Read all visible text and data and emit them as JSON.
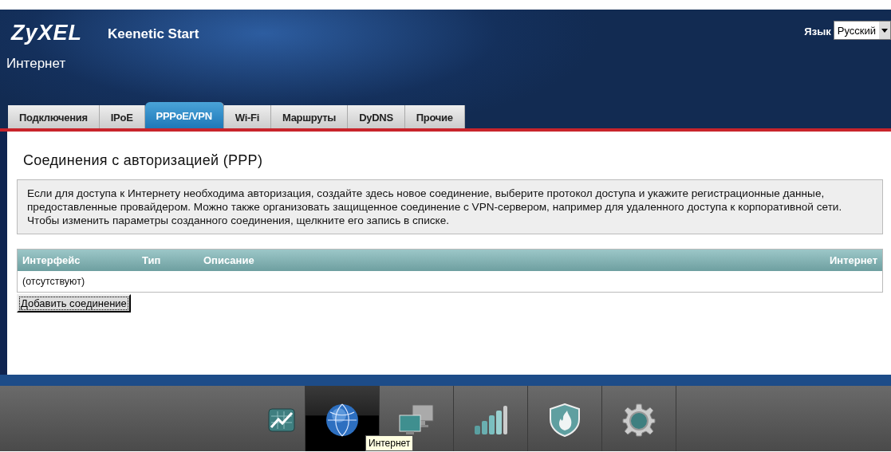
{
  "header": {
    "logo": "ZyXEL",
    "model": "Keenetic Start",
    "language_label": "Язык",
    "language_value": "Русский",
    "section_title": "Интернет"
  },
  "tabs": [
    {
      "label": "Подключения",
      "selected": false
    },
    {
      "label": "IPoE",
      "selected": false
    },
    {
      "label": "PPPoE/VPN",
      "selected": true
    },
    {
      "label": "Wi-Fi",
      "selected": false
    },
    {
      "label": "Маршруты",
      "selected": false
    },
    {
      "label": "DyDNS",
      "selected": false
    },
    {
      "label": "Прочие",
      "selected": false
    }
  ],
  "page": {
    "title": "Соединения с авторизацией (PPP)",
    "info": "Если для доступа к Интернету необходима авторизация, создайте здесь новое соединение, выберите протокол доступа и укажите регистрационные данные, предоставленные провайдером. Можно также организовать защищенное соединение с VPN-сервером, например для удаленного доступа к корпоративной сети. Чтобы изменить параметры созданного соединения, щелкните его запись в списке."
  },
  "table": {
    "columns": [
      "Интерфейс",
      "Тип",
      "Описание",
      "Интернет"
    ],
    "empty_text": "(отсутствуют)"
  },
  "add_button": "Добавить соединение",
  "dock": [
    {
      "kind": "chart",
      "selected": false
    },
    {
      "kind": "globe",
      "selected": true
    },
    {
      "kind": "computers",
      "selected": false
    },
    {
      "kind": "signal",
      "selected": false
    },
    {
      "kind": "shield",
      "selected": false
    },
    {
      "kind": "gear",
      "selected": false
    }
  ],
  "tooltip": "Интернет"
}
